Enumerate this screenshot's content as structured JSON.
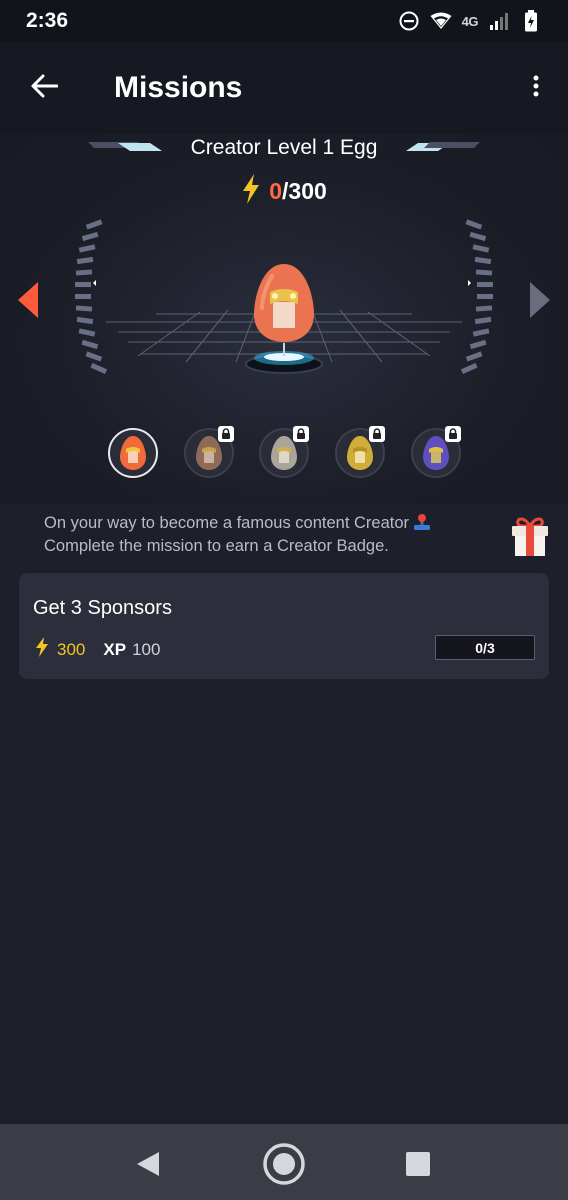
{
  "status_bar": {
    "time": "2:36",
    "network": "4G",
    "icons": [
      "do-not-disturb-icon",
      "wifi-icon",
      "signal-icon",
      "battery-icon"
    ]
  },
  "app_bar": {
    "title": "Missions",
    "back_icon": "arrow-left-icon",
    "menu_icon": "more-vert-icon"
  },
  "egg": {
    "title": "Creator Level 1 Egg",
    "points_current": "0",
    "points_total": "/300",
    "progress_fraction": 0,
    "thumbnails": [
      {
        "name": "egg-level-1",
        "locked": false,
        "selected": true,
        "color": "#f06a3a"
      },
      {
        "name": "egg-level-2",
        "locked": true,
        "selected": false,
        "color": "#9a6b55"
      },
      {
        "name": "egg-level-3",
        "locked": true,
        "selected": false,
        "color": "#b5b0a0"
      },
      {
        "name": "egg-level-4",
        "locked": true,
        "selected": false,
        "color": "#d8b63a"
      },
      {
        "name": "egg-level-5",
        "locked": true,
        "selected": false,
        "color": "#6a55c8"
      }
    ]
  },
  "description": {
    "line1": "On your way to become a famous content Creator",
    "line2": "Complete the mission to earn a Creator Badge."
  },
  "mission": {
    "title": "Get 3 Sponsors",
    "points": "300",
    "xp_label": "XP",
    "xp_value": "100",
    "progress_text": "0/3",
    "progress_fraction": 0
  },
  "colors": {
    "accent_orange": "#ff6a45",
    "accent_yellow": "#f4c324",
    "background": "#1d1f2a",
    "card": "#2c2e3c"
  }
}
